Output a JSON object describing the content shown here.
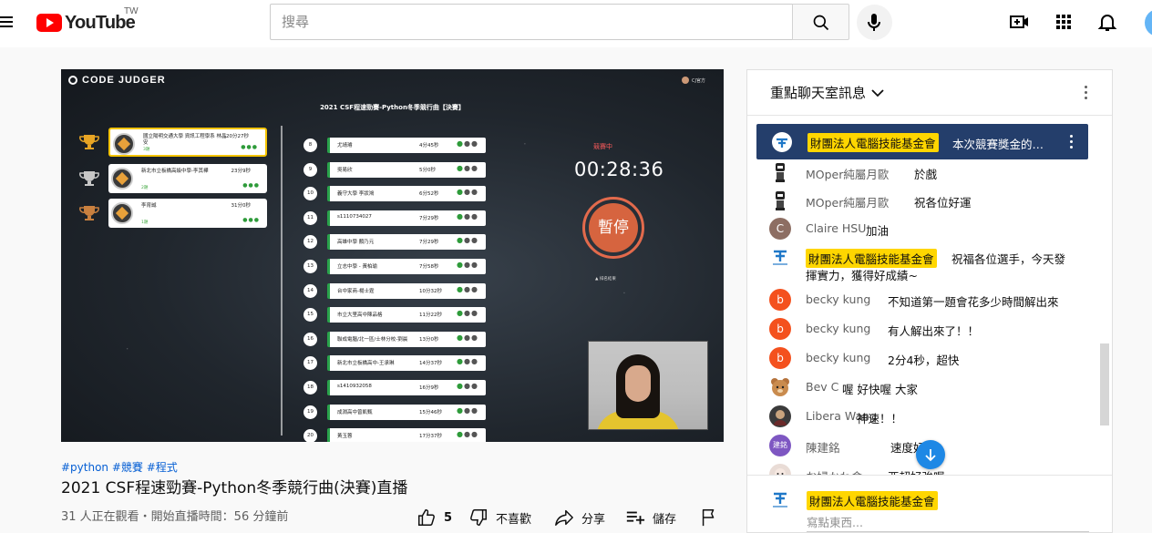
{
  "masthead": {
    "logo_text": "YouTube",
    "country_code": "TW",
    "search_placeholder": "搜尋",
    "icons": [
      "menu-icon",
      "search-icon",
      "mic-icon",
      "create-video-icon",
      "apps-icon",
      "notifications-icon"
    ]
  },
  "video": {
    "cj_brand": "CODE JUDGER",
    "cj_user": "CJ官方",
    "contest_title": "2021 CSF程速勁賽-Python冬季競行曲【決賽】",
    "status": "競賽中",
    "timer": "00:28:36",
    "pause_label": "暫停",
    "results_label": "▲ 排名結果",
    "podium": [
      {
        "name": "國立陽明交通大學 資訊工程學系 林晶安",
        "solved": "3題",
        "time": "20分27秒"
      },
      {
        "name": "新北市立板橋高級中學-李其樺",
        "solved": "2題",
        "time": "23分9秒"
      },
      {
        "name": "李育誠",
        "solved": "1題",
        "time": "31分0秒"
      }
    ],
    "ranking": [
      {
        "rank": "8",
        "name": "尤靖璿",
        "time": "4分45秒"
      },
      {
        "rank": "9",
        "name": "吳易欣",
        "time": "5分0秒"
      },
      {
        "rank": "10",
        "name": "義守大學 李狀鴻",
        "time": "6分52秒"
      },
      {
        "rank": "11",
        "name": "s1110734027",
        "time": "7分29秒"
      },
      {
        "rank": "12",
        "name": "高雄中學 顏乃元",
        "time": "7分29秒"
      },
      {
        "rank": "13",
        "name": "立志中學 - 黃柏瑜",
        "time": "7分58秒"
      },
      {
        "rank": "14",
        "name": "台中家商-楊士霆",
        "time": "10分32秒"
      },
      {
        "rank": "15",
        "name": "市立大里高中陳品格",
        "time": "11分22秒"
      },
      {
        "rank": "16",
        "name": "聯成電腦/北一區/士林分校-劉晨",
        "time": "13分0秒"
      },
      {
        "rank": "17",
        "name": "新北市立板橋高中-王承琳",
        "time": "14分37秒"
      },
      {
        "rank": "18",
        "name": "s1410932058",
        "time": "16分9秒"
      },
      {
        "rank": "19",
        "name": "成淵高中曾凱甄",
        "time": "15分46秒"
      },
      {
        "rank": "20",
        "name": "黃玉蓉",
        "time": "17分37秒"
      }
    ]
  },
  "info": {
    "hashtags": "#python #競賽 #程式",
    "title": "2021 CSF程速勁賽-Python冬季競行曲(決賽)直播",
    "views": "31 人正在觀看・開始直播時間：56 分鐘前",
    "like_count": "5",
    "dislike_label": "不喜歡",
    "share_label": "分享",
    "save_label": "儲存"
  },
  "chat": {
    "mode_label": "重點聊天室訊息",
    "pinned": {
      "author": "財團法人電腦技能基金會",
      "message": "本次競賽獎金的…"
    },
    "messages": [
      {
        "author": "MOper純屬月歐",
        "text": "於戲",
        "avatar": "robot"
      },
      {
        "author": "MOper純屬月歐",
        "text": "祝各位好運",
        "avatar": "robot"
      },
      {
        "author": "Claire HSU",
        "text": "加油",
        "avatar": "C",
        "color": "#8d6e63"
      },
      {
        "author": "財團法人電腦技能基金會",
        "text": "祝福各位選手，今天發",
        "text2": "揮實力，獲得好成績~",
        "avatar": "logo",
        "owner": true
      },
      {
        "author": "becky kung",
        "text": "不知道第一題會花多少時間解出來",
        "avatar": "b",
        "color": "#f4511e"
      },
      {
        "author": "becky kung",
        "text": "有人解出來了！！",
        "avatar": "b",
        "color": "#f4511e"
      },
      {
        "author": "becky kung",
        "text": "2分4秒，超快",
        "avatar": "b",
        "color": "#f4511e"
      },
      {
        "author": "Bev C",
        "text": "喔 好快喔 大家",
        "avatar": "bear"
      },
      {
        "author": "Libera Wang",
        "text": "神速！！",
        "avatar": "dark"
      },
      {
        "author": "陳建銘",
        "text": "速度好快",
        "avatar": "建銘",
        "color": "#7e57c2"
      },
      {
        "author": "お婦かわ舍",
        "text": "亞超好強喔",
        "avatar": "doll"
      }
    ],
    "input_author": "財團法人電腦技能基金會",
    "input_placeholder": "寫點東西..."
  }
}
